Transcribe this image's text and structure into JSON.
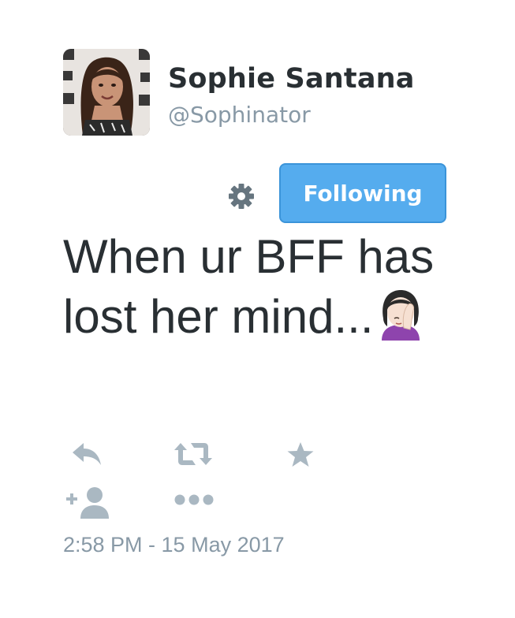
{
  "user": {
    "display_name": "Sophie Santana",
    "handle": "@Sophinator"
  },
  "actions": {
    "follow_label": "Following"
  },
  "tweet": {
    "text": "When ur BFF has lost her mind...",
    "emoji": "face-palm-woman-emoji",
    "timestamp": "2:58 PM - 15 May 2017"
  },
  "icons": {
    "settings": "gear-icon",
    "reply": "reply-icon",
    "retweet": "retweet-icon",
    "favorite": "star-icon",
    "add_user": "add-user-icon",
    "more": "more-icon"
  },
  "colors": {
    "follow_button": "#55acee",
    "icon_gray": "#aab8c2",
    "muted_text": "#8899a6"
  }
}
